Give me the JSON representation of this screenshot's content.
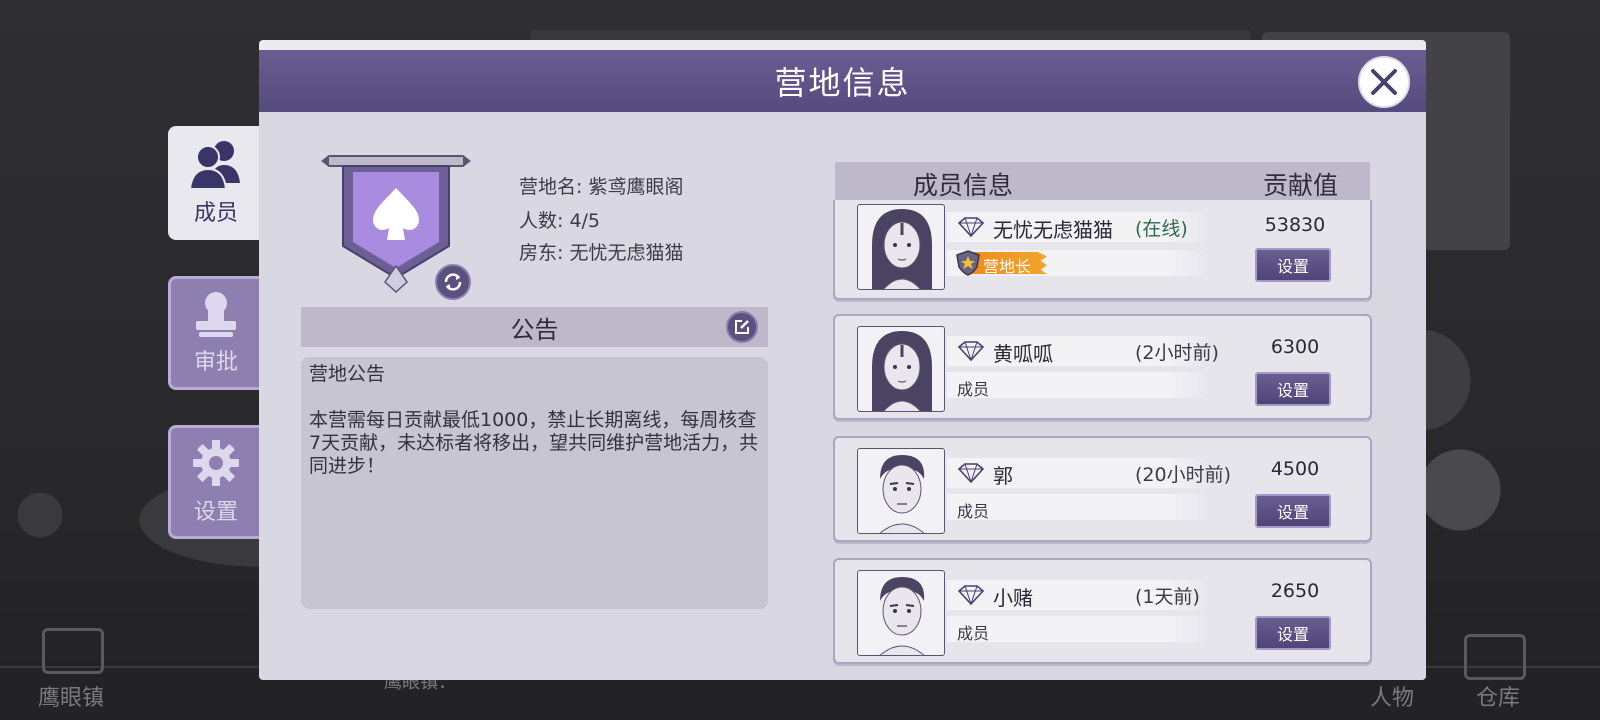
{
  "dialog": {
    "title": "营地信息"
  },
  "tabs": [
    {
      "label": "成员",
      "icon": "members-icon",
      "active": true
    },
    {
      "label": "审批",
      "icon": "approval-icon",
      "active": false
    },
    {
      "label": "设置",
      "icon": "gear-icon",
      "active": false
    }
  ],
  "camp": {
    "name_line": "营地名: 紫鸢鹰眼阁",
    "count_line": "人数:  4/5",
    "owner_line": "房东:  无忧无虑猫猫",
    "emblem_icon": "spade-icon",
    "emblem_color": "#a98be0"
  },
  "notice": {
    "title": "公告",
    "content": "营地公告\n\n本营需每日贡献最低1000，禁止长期离线，每周核查7天贡献，未达标者将移出，望共同维护营地活力，共同进步！"
  },
  "members_panel": {
    "header_title": "成员信息",
    "header_contribution": "贡献值",
    "members": [
      {
        "name": "无忧无虑猫猫",
        "status": "(在线)",
        "role": "营地长",
        "contribution": "53830",
        "button": "设置"
      },
      {
        "name": "黄呱呱",
        "status": "(2小时前)",
        "role": "成员",
        "contribution": "6300",
        "button": "设置"
      },
      {
        "name": "郭",
        "status": "(20小时前)",
        "role": "成员",
        "contribution": "4500",
        "button": "设置"
      },
      {
        "name": "小赌",
        "status": "(1天前)",
        "role": "成员",
        "contribution": "2650",
        "button": "设置"
      }
    ]
  },
  "background": {
    "left_label": "鹰眼镇",
    "center_label": "鹰眼镇：",
    "right_label_1": "人物",
    "right_label_2": "仓库"
  },
  "colors": {
    "header": "#5f5288",
    "accent": "#8d80b0",
    "online": "#2f6a4a",
    "leader_badge": "#f08a1c"
  }
}
